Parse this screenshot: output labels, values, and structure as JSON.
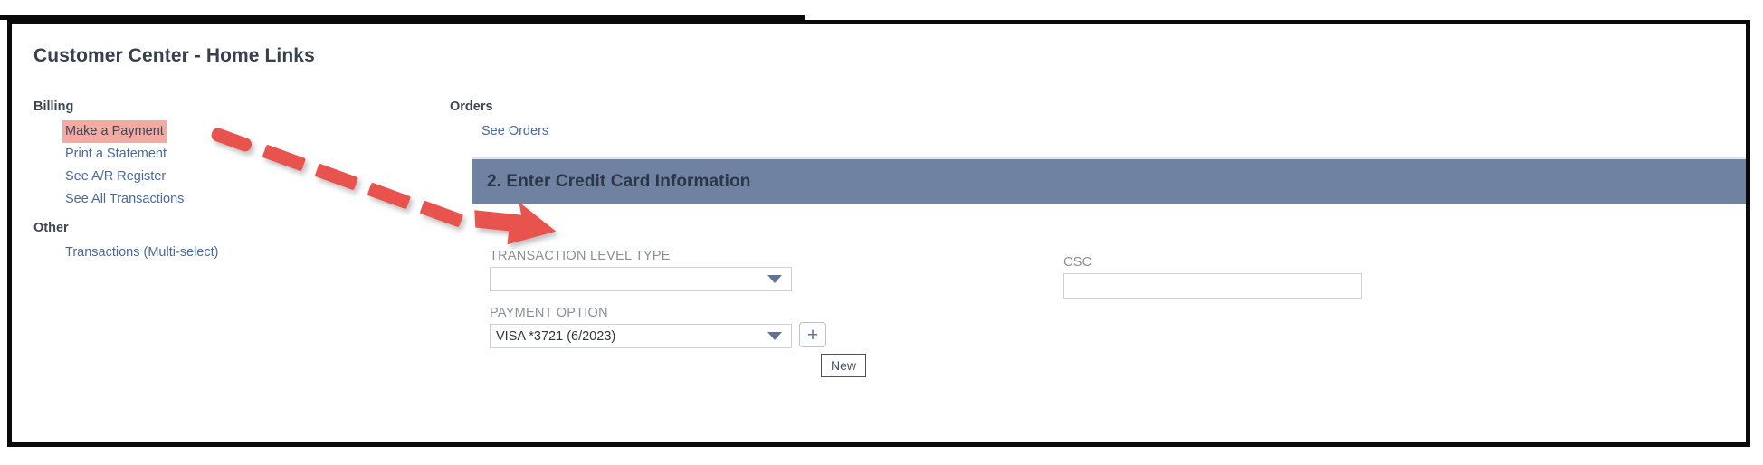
{
  "page_title": "Customer Center - Home Links",
  "left_column": {
    "groups": [
      {
        "heading": "Billing",
        "links": [
          {
            "label": "Make a Payment",
            "highlighted": true
          },
          {
            "label": "Print a Statement",
            "highlighted": false
          },
          {
            "label": "See A/R Register",
            "highlighted": false
          },
          {
            "label": "See All Transactions",
            "highlighted": false
          }
        ]
      },
      {
        "heading": "Other",
        "links": [
          {
            "label": "Transactions (Multi-select)",
            "highlighted": false
          }
        ]
      }
    ]
  },
  "right_column": {
    "groups": [
      {
        "heading": "Orders",
        "links": [
          {
            "label": "See Orders",
            "highlighted": false
          }
        ]
      }
    ]
  },
  "section": {
    "title": "2. Enter Credit Card Information",
    "header_color": "#6f82a2"
  },
  "form": {
    "transaction_level_type": {
      "label": "TRANSACTION LEVEL TYPE",
      "value": "",
      "placeholder": ""
    },
    "payment_option": {
      "label": "PAYMENT OPTION",
      "value": "VISA *3721 (6/2023)",
      "placeholder": ""
    },
    "csc": {
      "label": "CSC",
      "value": "",
      "placeholder": ""
    },
    "new_button": {
      "glyph": "+",
      "tooltip": "New"
    }
  },
  "annotation": {
    "arrow_color": "#e8534d",
    "highlight_color": "#f4a9a3",
    "description": "dashed red arrow pointing from Make a Payment to the section header"
  },
  "icons": {
    "grip": "grip-dots-icon",
    "caret": "chevron-down-icon",
    "plus": "plus-icon"
  }
}
